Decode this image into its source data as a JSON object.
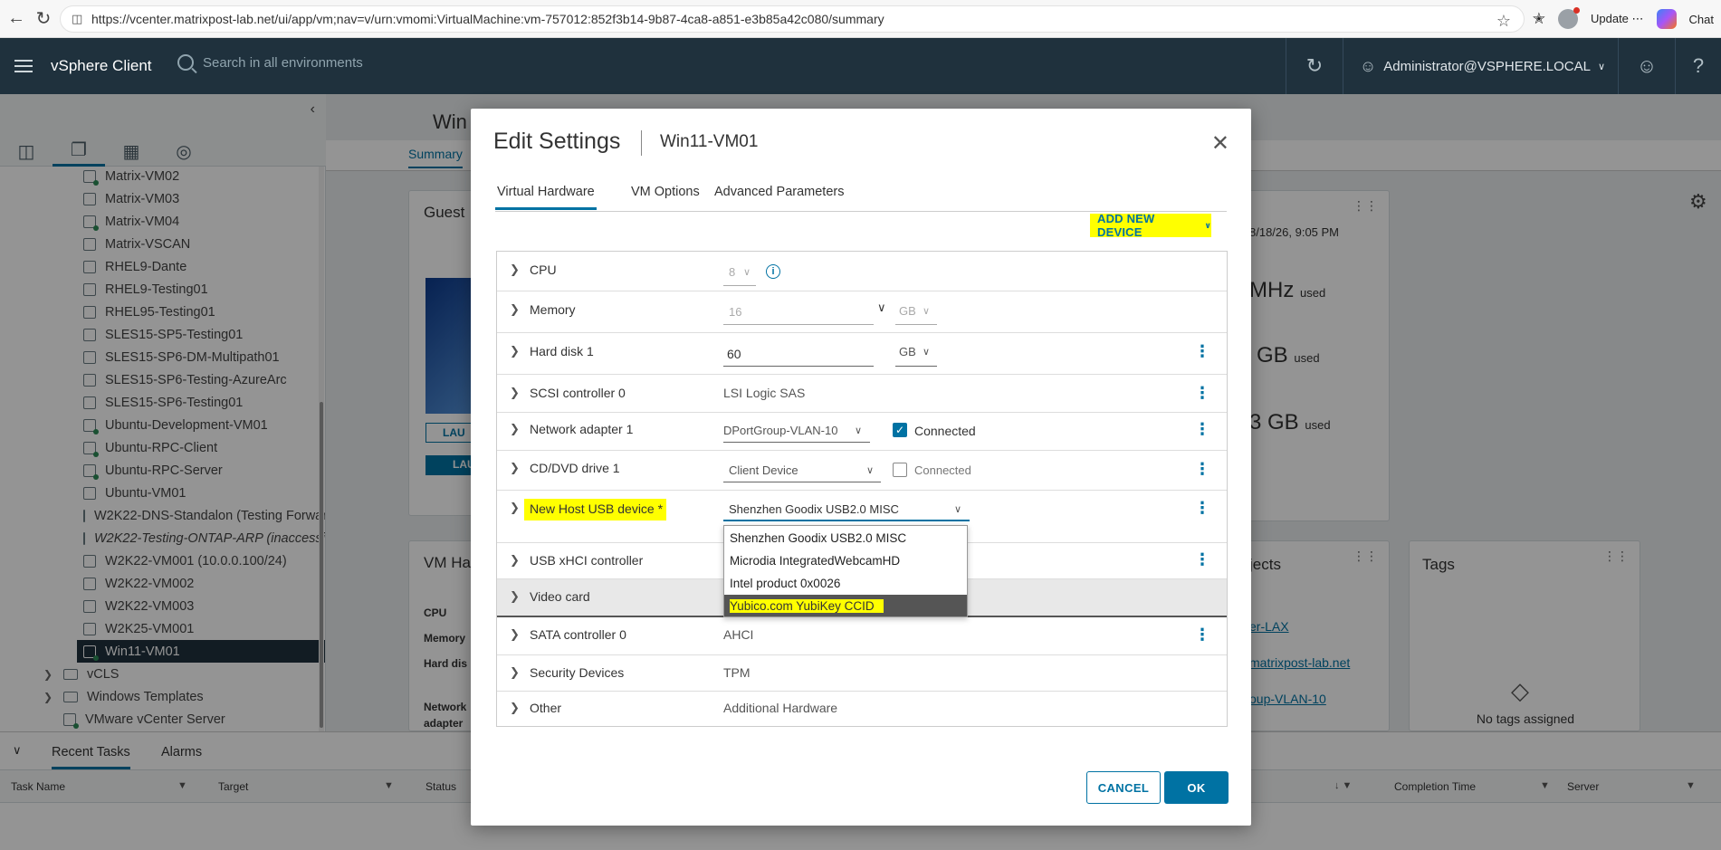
{
  "browser": {
    "url": "https://vcenter.matrixpost-lab.net/ui/app/vm;nav=v/urn:vmomi:VirtualMachine:vm-757012:852f3b14-9b87-4ca8-a851-e3b85a42c080/summary",
    "update_label": "Update",
    "chat_label": "Chat"
  },
  "header": {
    "app_title": "vSphere Client",
    "search_placeholder": "Search in all environments",
    "user": "Administrator@VSPHERE.LOCAL"
  },
  "tree": {
    "items": [
      {
        "label": "Matrix-VM02",
        "state": "on"
      },
      {
        "label": "Matrix-VM03",
        "state": "off"
      },
      {
        "label": "Matrix-VM04",
        "state": "on"
      },
      {
        "label": "Matrix-VSCAN",
        "state": "off"
      },
      {
        "label": "RHEL9-Dante",
        "state": "off"
      },
      {
        "label": "RHEL9-Testing01",
        "state": "off"
      },
      {
        "label": "RHEL95-Testing01",
        "state": "off"
      },
      {
        "label": "SLES15-SP5-Testing01",
        "state": "off"
      },
      {
        "label": "SLES15-SP6-DM-Multipath01",
        "state": "off"
      },
      {
        "label": "SLES15-SP6-Testing-AzureArc",
        "state": "off"
      },
      {
        "label": "SLES15-SP6-Testing01",
        "state": "off"
      },
      {
        "label": "Ubuntu-Development-VM01",
        "state": "on"
      },
      {
        "label": "Ubuntu-RPC-Client",
        "state": "on"
      },
      {
        "label": "Ubuntu-RPC-Server",
        "state": "on"
      },
      {
        "label": "Ubuntu-VM01",
        "state": "off"
      },
      {
        "label": "W2K22-DNS-Standalon (Testing Forwarding)",
        "state": "off"
      },
      {
        "label": "W2K22-Testing-ONTAP-ARP (inaccessible)",
        "state": "off"
      },
      {
        "label": "W2K22-VM001 (10.0.0.100/24)",
        "state": "off"
      },
      {
        "label": "W2K22-VM002",
        "state": "off"
      },
      {
        "label": "W2K22-VM003",
        "state": "off"
      },
      {
        "label": "W2K25-VM001",
        "state": "off"
      },
      {
        "label": "Win11-VM01",
        "state": "on"
      }
    ],
    "folders": [
      "vCLS",
      "Windows Templates"
    ],
    "vcenter": "VMware vCenter Server"
  },
  "main": {
    "title": "Win",
    "tab_summary": "Summary",
    "guest_card": "Guest",
    "launch1": "LAU",
    "launch2": "LAU",
    "vm_hardware": "VM Ha",
    "hw_cpu": "CPU",
    "hw_memory": "Memory",
    "hw_disk": "Hard dis",
    "hw_network": "Network",
    "hw_adapter": "adapter",
    "date": "8/18/26, 9:05 PM",
    "cpu_used": "MHz",
    "mem_used": "GB",
    "storage_used": "3 GB",
    "used_label": "used",
    "objects": "jects",
    "link1": "er-LAX",
    "link2": "matrixpost-lab.net",
    "link3": "oup-VLAN-10",
    "tags_title": "Tags",
    "tags_empty": "No tags assigned"
  },
  "tasks": {
    "tab_recent": "Recent Tasks",
    "tab_alarms": "Alarms",
    "col_task": "Task Name",
    "col_target": "Target",
    "col_status": "Status",
    "col_completion": "Completion Time",
    "col_server": "Server"
  },
  "dialog": {
    "title": "Edit Settings",
    "vm_name": "Win11-VM01",
    "tabs": [
      "Virtual Hardware",
      "VM Options",
      "Advanced Parameters"
    ],
    "add_new_device": "ADD NEW DEVICE",
    "rows": {
      "cpu": {
        "label": "CPU",
        "value": "8"
      },
      "memory": {
        "label": "Memory",
        "value": "16",
        "unit": "GB"
      },
      "hard_disk": {
        "label": "Hard disk 1",
        "value": "60",
        "unit": "GB"
      },
      "scsi": {
        "label": "SCSI controller 0",
        "value": "LSI Logic SAS"
      },
      "network": {
        "label": "Network adapter 1",
        "value": "DPortGroup-VLAN-10",
        "connected": "Connected"
      },
      "cddvd": {
        "label": "CD/DVD drive 1",
        "value": "Client Device",
        "connected": "Connected"
      },
      "usb_device": {
        "label": "New Host USB device *",
        "value": "Shenzhen Goodix USB2.0 MISC"
      },
      "usb_xhci": {
        "label": "USB xHCI controller"
      },
      "video": {
        "label": "Video card"
      },
      "sata": {
        "label": "SATA controller 0",
        "value": "AHCI"
      },
      "security": {
        "label": "Security Devices",
        "value": "TPM"
      },
      "other": {
        "label": "Other",
        "value": "Additional Hardware"
      }
    },
    "usb_options": [
      "Shenzhen Goodix USB2.0 MISC",
      "Microdia IntegratedWebcamHD",
      "Intel product 0x0026",
      "Yubico.com YubiKey CCID"
    ],
    "cancel": "CANCEL",
    "ok": "OK"
  },
  "colors": {
    "header_bg": "#1f313d",
    "accent": "#0072a3",
    "highlight": "#ffff00"
  }
}
